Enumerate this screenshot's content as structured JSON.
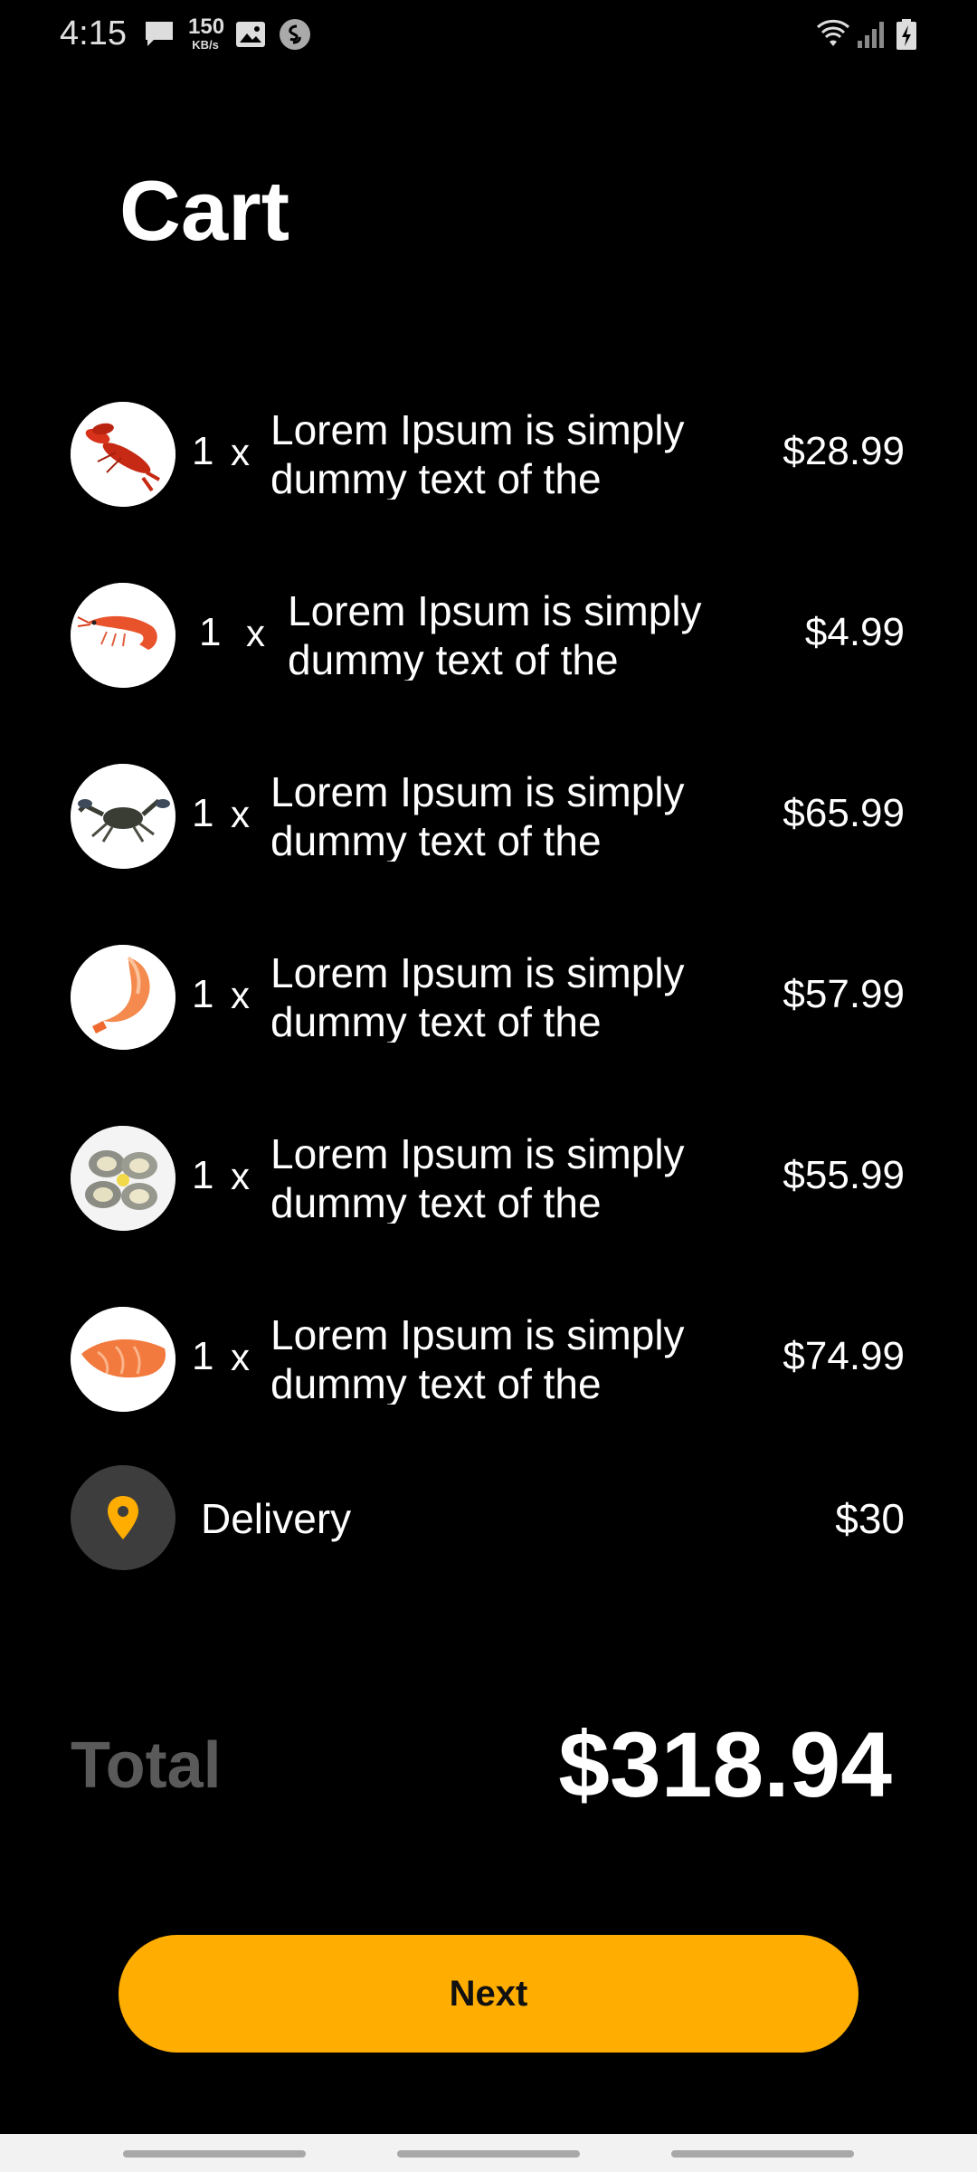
{
  "status_bar": {
    "time": "4:15",
    "speed_value": "150",
    "speed_unit": "KB/s",
    "icons": [
      "message-icon",
      "network-speed",
      "image-icon",
      "shazam-icon",
      "wifi-icon",
      "signal-icon",
      "battery-charging-icon"
    ]
  },
  "title": "Cart",
  "items": [
    {
      "qty": "1",
      "mult": "x",
      "line1": "Lorem Ipsum is simply",
      "line2": "dummy text of the",
      "price": "$28.99",
      "image": "lobster"
    },
    {
      "qty": "1",
      "mult": "x",
      "line1": "Lorem Ipsum is simply",
      "line2": "dummy text of the",
      "price": "$4.99",
      "image": "prawn"
    },
    {
      "qty": "1",
      "mult": "x",
      "line1": "Lorem Ipsum is simply",
      "line2": "dummy text of the",
      "price": "$65.99",
      "image": "crab"
    },
    {
      "qty": "1",
      "mult": "x",
      "line1": "Lorem Ipsum is simply",
      "line2": "dummy text of the",
      "price": "$57.99",
      "image": "shrimp"
    },
    {
      "qty": "1",
      "mult": "x",
      "line1": "Lorem Ipsum is simply",
      "line2": "dummy text of the",
      "price": "$55.99",
      "image": "oysters"
    },
    {
      "qty": "1",
      "mult": "x",
      "line1": "Lorem Ipsum is simply",
      "line2": "dummy text of the",
      "price": "$74.99",
      "image": "salmon"
    }
  ],
  "delivery": {
    "label": "Delivery",
    "price": "$30",
    "icon": "location-pin-icon"
  },
  "total": {
    "label": "Total",
    "value": "$318.94"
  },
  "next_button": {
    "label": "Next"
  },
  "colors": {
    "accent": "#ffad00",
    "background": "#000000",
    "muted": "#5a5a5a"
  }
}
